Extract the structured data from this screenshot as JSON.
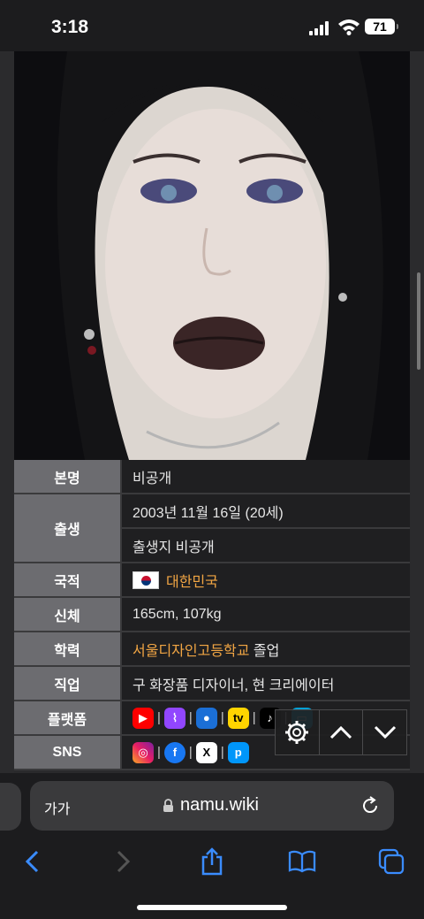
{
  "status_bar": {
    "time": "3:18",
    "battery": "71"
  },
  "profile": {
    "rows": [
      {
        "label": "본명",
        "values": [
          "비공개"
        ]
      },
      {
        "label": "출생",
        "values": [
          "2003년 11월 16일 (20세)",
          "출생지 비공개"
        ]
      },
      {
        "label": "국적",
        "value": "대한민국",
        "flag": "south-korea-flag"
      },
      {
        "label": "신체",
        "value": "165cm, 107kg"
      },
      {
        "label": "학력",
        "link": "서울디자인고등학교",
        "suffix": " 졸업"
      },
      {
        "label": "직업",
        "value": "구 화장품 디자이너, 현 크리에이터"
      },
      {
        "label": "플랫폼",
        "icons": [
          "youtube-icon",
          "twitch-icon",
          "chzzk-icon",
          "kakaotv-icon",
          "tiktok-icon",
          "bilibili-icon"
        ]
      },
      {
        "label": "SNS",
        "icons": [
          "instagram-icon",
          "facebook-icon",
          "x-icon",
          "pixiv-icon"
        ]
      }
    ]
  },
  "browser": {
    "text_size_label": "가가",
    "host": "namu.wiki"
  },
  "colors": {
    "link": "#f2a644",
    "label_bg": "#6c6c70",
    "value_bg": "#1f1f21"
  }
}
